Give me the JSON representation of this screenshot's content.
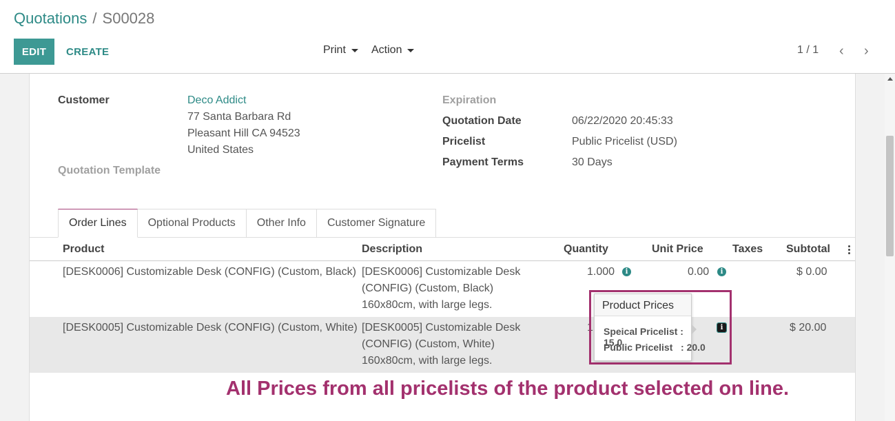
{
  "breadcrumb": {
    "parent": "Quotations",
    "separator": "/",
    "current": "S00028"
  },
  "toolbar": {
    "edit_label": "EDIT",
    "create_label": "CREATE",
    "print_label": "Print",
    "action_label": "Action"
  },
  "pager": {
    "value": "1 / 1",
    "prev_icon": "chevron-left-icon",
    "next_icon": "chevron-right-icon"
  },
  "form": {
    "customer_label": "Customer",
    "customer_name": "Deco Addict",
    "address_line1": "77 Santa Barbara Rd",
    "address_line2": "Pleasant Hill CA 94523",
    "address_line3": "United States",
    "template_label": "Quotation Template",
    "expiration_label": "Expiration",
    "quotation_date_label": "Quotation Date",
    "quotation_date_value": "06/22/2020 20:45:33",
    "pricelist_label": "Pricelist",
    "pricelist_value": "Public Pricelist (USD)",
    "payment_terms_label": "Payment Terms",
    "payment_terms_value": "30 Days"
  },
  "tabs": [
    {
      "label": "Order Lines",
      "active": true
    },
    {
      "label": "Optional Products",
      "active": false
    },
    {
      "label": "Other Info",
      "active": false
    },
    {
      "label": "Customer Signature",
      "active": false
    }
  ],
  "table": {
    "headers": {
      "product": "Product",
      "description": "Description",
      "quantity": "Quantity",
      "unit_price": "Unit Price",
      "taxes": "Taxes",
      "subtotal": "Subtotal"
    },
    "rows": [
      {
        "product": "[DESK0006] Customizable Desk (CONFIG) (Custom, Black)",
        "desc1": "[DESK0006] Customizable Desk",
        "desc2": "(CONFIG) (Custom, Black)",
        "desc3": "160x80cm, with large legs.",
        "quantity": "1.000",
        "unit_price": "0.00",
        "subtotal": "$ 0.00"
      },
      {
        "product": "[DESK0005] Customizable Desk (CONFIG) (Custom, White)",
        "desc1": "[DESK0005] Customizable Desk",
        "desc2": "(CONFIG) (Custom, White)",
        "desc3": "160x80cm, with large legs.",
        "quantity": "1",
        "unit_price": "",
        "subtotal": "$ 20.00"
      }
    ]
  },
  "popover": {
    "title": "Product Prices",
    "line1": "Speical Pricelist : 15.0",
    "line2": "Public Pricelist   : 20.0"
  },
  "annotation": "All Prices from all pricelists of the product selected on line.",
  "colors": {
    "accent": "#3d9994",
    "link": "#2d8a86",
    "annotation": "#a3316e"
  }
}
